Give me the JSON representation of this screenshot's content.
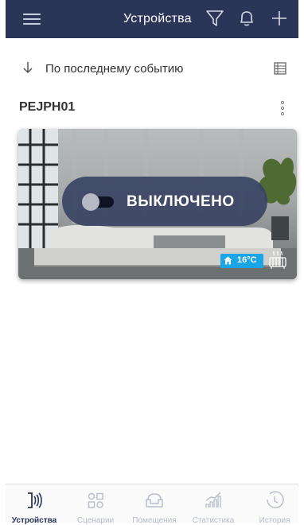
{
  "header": {
    "title": "Устройства"
  },
  "sort": {
    "label": "По последнему событию"
  },
  "device": {
    "name": "PEJPH01",
    "state_label": "ВЫКЛЮЧЕНО",
    "temperature": "16°C"
  },
  "bottom_nav": {
    "items": [
      {
        "label": "Устройства",
        "icon": "devices-icon",
        "active": true
      },
      {
        "label": "Сценарии",
        "icon": "scenarios-icon",
        "active": false
      },
      {
        "label": "Помещения",
        "icon": "rooms-icon",
        "active": false
      },
      {
        "label": "Статистика",
        "icon": "statistics-icon",
        "active": false
      },
      {
        "label": "История",
        "icon": "history-icon",
        "active": false
      }
    ]
  },
  "colors": {
    "header_bg": "#2b3557",
    "accent_badge": "#1aa6e4",
    "nav_inactive": "#b7bcc9"
  }
}
